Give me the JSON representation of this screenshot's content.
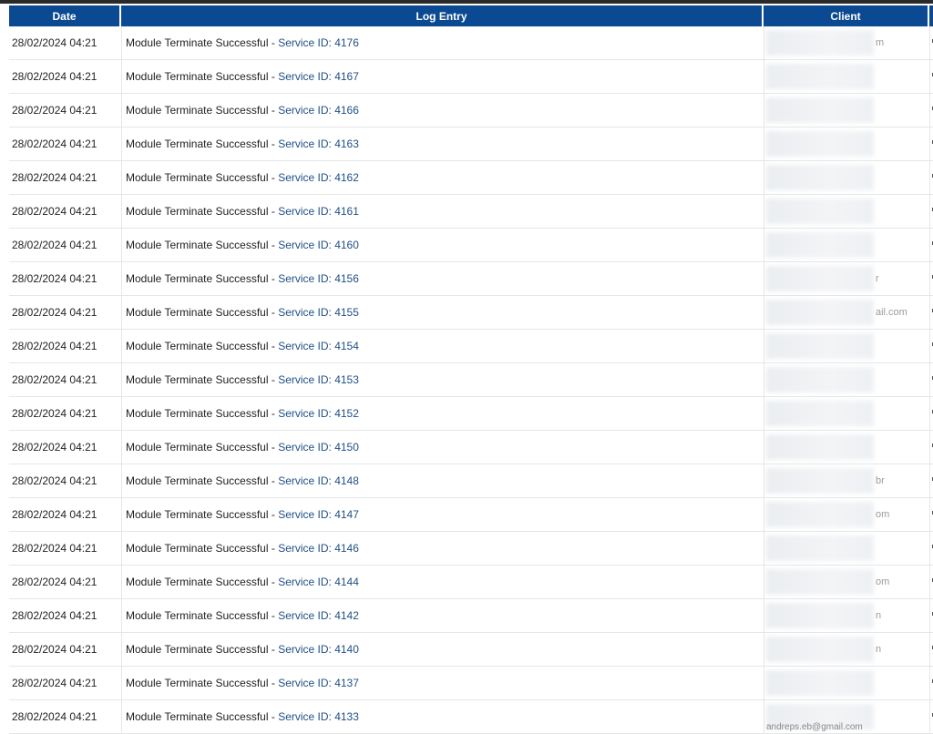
{
  "columns": {
    "date": "Date",
    "log_entry": "Log Entry",
    "client": "Client"
  },
  "rows": [
    {
      "date": "28/02/2024 04:21",
      "entry": "Module Terminate Successful - ",
      "service": "Service ID: 4176",
      "client_frag": "m"
    },
    {
      "date": "28/02/2024 04:21",
      "entry": "Module Terminate Successful - ",
      "service": "Service ID: 4167",
      "client_frag": ""
    },
    {
      "date": "28/02/2024 04:21",
      "entry": "Module Terminate Successful - ",
      "service": "Service ID: 4166",
      "client_frag": ""
    },
    {
      "date": "28/02/2024 04:21",
      "entry": "Module Terminate Successful - ",
      "service": "Service ID: 4163",
      "client_frag": ""
    },
    {
      "date": "28/02/2024 04:21",
      "entry": "Module Terminate Successful - ",
      "service": "Service ID: 4162",
      "client_frag": ""
    },
    {
      "date": "28/02/2024 04:21",
      "entry": "Module Terminate Successful - ",
      "service": "Service ID: 4161",
      "client_frag": ""
    },
    {
      "date": "28/02/2024 04:21",
      "entry": "Module Terminate Successful - ",
      "service": "Service ID: 4160",
      "client_frag": ""
    },
    {
      "date": "28/02/2024 04:21",
      "entry": "Module Terminate Successful - ",
      "service": "Service ID: 4156",
      "client_frag": "r"
    },
    {
      "date": "28/02/2024 04:21",
      "entry": "Module Terminate Successful - ",
      "service": "Service ID: 4155",
      "client_frag": "ail.com"
    },
    {
      "date": "28/02/2024 04:21",
      "entry": "Module Terminate Successful - ",
      "service": "Service ID: 4154",
      "client_frag": ""
    },
    {
      "date": "28/02/2024 04:21",
      "entry": "Module Terminate Successful - ",
      "service": "Service ID: 4153",
      "client_frag": ""
    },
    {
      "date": "28/02/2024 04:21",
      "entry": "Module Terminate Successful - ",
      "service": "Service ID: 4152",
      "client_frag": ""
    },
    {
      "date": "28/02/2024 04:21",
      "entry": "Module Terminate Successful - ",
      "service": "Service ID: 4150",
      "client_frag": ""
    },
    {
      "date": "28/02/2024 04:21",
      "entry": "Module Terminate Successful - ",
      "service": "Service ID: 4148",
      "client_frag": "br"
    },
    {
      "date": "28/02/2024 04:21",
      "entry": "Module Terminate Successful - ",
      "service": "Service ID: 4147",
      "client_frag": "om"
    },
    {
      "date": "28/02/2024 04:21",
      "entry": "Module Terminate Successful - ",
      "service": "Service ID: 4146",
      "client_frag": ""
    },
    {
      "date": "28/02/2024 04:21",
      "entry": "Module Terminate Successful - ",
      "service": "Service ID: 4144",
      "client_frag": "om"
    },
    {
      "date": "28/02/2024 04:21",
      "entry": "Module Terminate Successful - ",
      "service": "Service ID: 4142",
      "client_frag": "n"
    },
    {
      "date": "28/02/2024 04:21",
      "entry": "Module Terminate Successful - ",
      "service": "Service ID: 4140",
      "client_frag": "n"
    },
    {
      "date": "28/02/2024 04:21",
      "entry": "Module Terminate Successful - ",
      "service": "Service ID: 4137",
      "client_frag": ""
    },
    {
      "date": "28/02/2024 04:21",
      "entry": "Module Terminate Successful - ",
      "service": "Service ID: 4133",
      "client_frag": ""
    }
  ],
  "footer_email": "andreps.eb@gmail.com",
  "colors": {
    "header_bg": "#0b4a92",
    "service_link": "#1f4f86"
  }
}
